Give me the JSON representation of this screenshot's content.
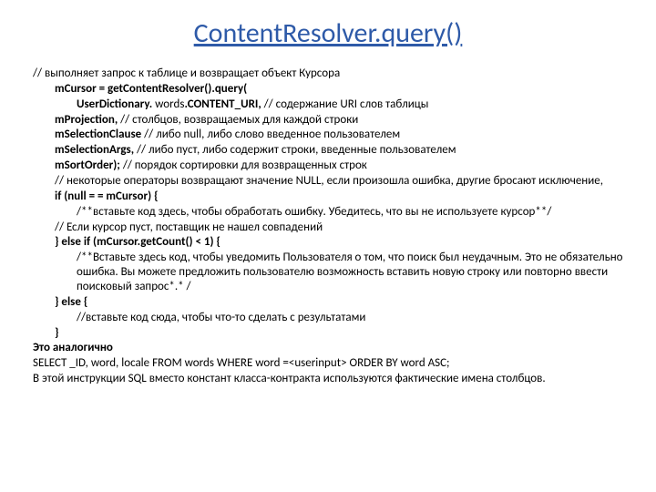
{
  "title": "ContentResolver.query()",
  "lines": {
    "l1_a": "// выполняет запрос к таблице и возвращает объект Курсора",
    "l2_b": "mCursor = getContentResolver().query(",
    "l3_a": "UserDictionary.",
    "l3_b": " words",
    "l3_c": ".CONTENT_URI,",
    "l3_d": "  // содержание URI слов таблицы",
    "l4_b": "mProjection,",
    "l4_a": "                           // столбцов, возвращаемых для каждой строки",
    "l5_b": "mSelectionClause",
    "l5_a": "  // либо null, либо слово введенное пользователем",
    "l6_b": "mSelectionArgs,",
    "l6_a": "                // либо пуст, либо содержит строки, введенные пользователем",
    "l7_b": "mSortOrder);",
    "l7_a": "                       // порядок сортировки для возвращенных строк",
    "l8_a": "// некоторые операторы возвращают значение NULL, если произошла ошибка, другие бросают исключение,",
    "l9_b": "if (null = = mCursor) {",
    "l10_a": "/**вставьте код здесь, чтобы обработать ошибку. Убедитесь, что вы не используете курсор**/",
    "l11_a": "// Если курсор пуст, поставщик не нашел совпадений",
    "l12_b": "} else if (mCursor.getCount() < 1) {",
    "l13_a": "/**Вставьте здесь код, чтобы уведомить Пользователя о том, что поиск был неудачным. Это не обязательно ошибка. Вы можете предложить пользователю возможность вставить новую строку или повторно ввести поисковый запрос*.* /",
    "l14_b": "} else {",
    "l15_a": "//вставьте код сюда, чтобы что-то сделать с результатами",
    "l16_b": "}",
    "l17_b": "Это аналогично",
    "l18_a": "SELECT _ID, word, locale FROM words WHERE word =<userinput> ORDER BY word ASC;",
    "l19_a": "В этой инструкции SQL вместо констант класса-контракта используются фактические имена столбцов."
  }
}
